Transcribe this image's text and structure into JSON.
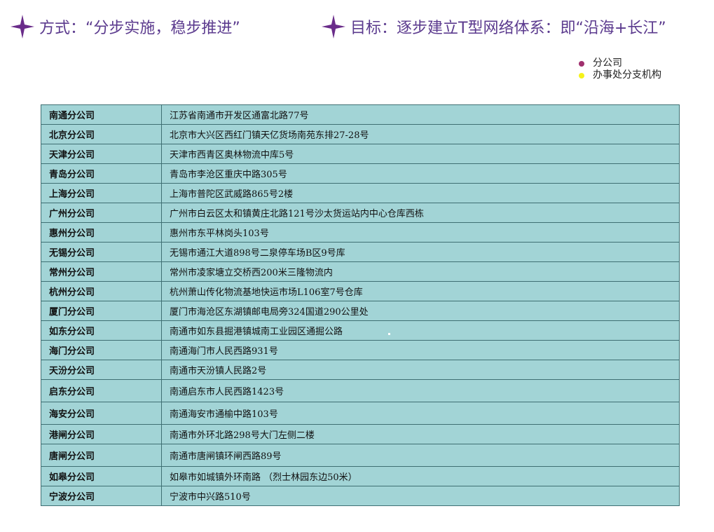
{
  "headings": {
    "left": "方式：“分步实施，稳步推进”",
    "right": "目标：逐步建立T型网络体系：即“沿海+长江”"
  },
  "colors": {
    "heading": "#5b3a8e",
    "star": "#6a2c8a",
    "table_bg": "#a2d4d6",
    "legend_branch": "#a0306e",
    "legend_office": "#f5f21a"
  },
  "legend": {
    "branch": "分公司",
    "office": "办事处分支机构"
  },
  "rows": [
    {
      "name": "南通分公司",
      "address": "江苏省南通市开发区通富北路77号"
    },
    {
      "name": "北京分公司",
      "address": "北京市大兴区西红门镇天亿货场南苑东排27-28号"
    },
    {
      "name": "天津分公司",
      "address": "天津市西青区奥林物流中库5号"
    },
    {
      "name": "青岛分公司",
      "address": "青岛市李沧区重庆中路305号"
    },
    {
      "name": "上海分公司",
      "address": "上海市普陀区武威路865号2楼"
    },
    {
      "name": "广州分公司",
      "address": "广州市白云区太和镇黄庄北路121号沙太货运站内中心仓库西栋"
    },
    {
      "name": "惠州分公司",
      "address": "惠州市东平林岗头103号"
    },
    {
      "name": "无锡分公司",
      "address": "无锡市通江大道898号二泉停车场B区9号库"
    },
    {
      "name": "常州分公司",
      "address": "常州市凌家塘立交桥西200米三隆物流内"
    },
    {
      "name": "杭州分公司",
      "address": "杭州萧山传化物流基地快运市场L106室7号仓库"
    },
    {
      "name": "厦门分公司",
      "address": "厦门市海沧区东湖镇邮电局旁324国道290公里处"
    },
    {
      "name": "如东分公司",
      "address": "南通市如东县掘港镇城南工业园区通掘公路"
    },
    {
      "name": "海门分公司",
      "address": "南通海门市人民西路931号"
    },
    {
      "name": "天汾分公司",
      "address": "南通市天汾镇人民路2号"
    },
    {
      "name": "启东分公司",
      "address": "南通启东市人民西路1423号"
    },
    {
      "name": "海安分公司",
      "address": "南通海安市通榆中路103号"
    },
    {
      "name": "港闸分公司",
      "address": "南通市外环北路298号大门左侧二楼"
    },
    {
      "name": "唐闸分公司",
      "address": "南通市唐闸镇环闸西路89号"
    },
    {
      "name": "如皋分公司",
      "address": "如皋市如城镇外环南路 （烈士林园东边50米）"
    },
    {
      "name": "宁波分公司",
      "address": "宁波市中兴路510号"
    }
  ]
}
